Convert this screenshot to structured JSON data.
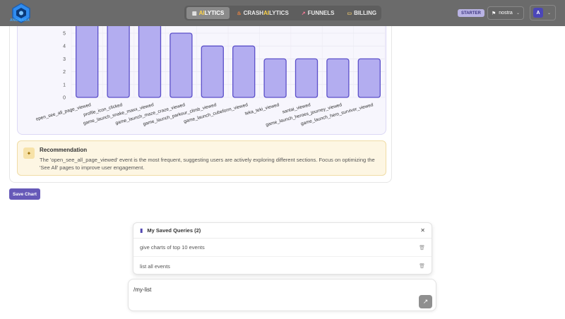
{
  "header": {
    "logo_icon": "brand-logo-icon",
    "tabs": [
      {
        "icon": "chart-icon",
        "prefix": "",
        "ai": "AI",
        "suffix": "LYTICS",
        "active": true
      },
      {
        "icon": "fire-icon",
        "prefix": "CRASH",
        "ai": "AI",
        "suffix": "LYTICS",
        "active": false
      },
      {
        "icon": "trend-icon",
        "prefix": "FUNNELS",
        "ai": "",
        "suffix": "",
        "active": false
      },
      {
        "icon": "card-icon",
        "prefix": "BILLING",
        "ai": "",
        "suffix": "",
        "active": false
      }
    ],
    "plan_badge": "STARTER",
    "project": "nostra",
    "avatar_initial": "A"
  },
  "chart_data": {
    "type": "bar",
    "categories": [
      "open_see_all_page_viewed",
      "profile_icon_clicked",
      "game_launch_snake_maxx_viewed",
      "game_launch_maze_craze_viewed",
      "game_launch_parkour_climb_viewed",
      "game_launch_cubeform_viewed",
      "teka_teki_viewed",
      "santai_viewed",
      "game_launch_heroes_journey_viewed",
      "game_launch_hero_survivor_viewed"
    ],
    "values": [
      6,
      6,
      6,
      5,
      4,
      4,
      3,
      3,
      3,
      3
    ],
    "yticks": [
      0,
      1,
      2,
      3,
      4,
      5
    ],
    "ylim": [
      0,
      6
    ],
    "grid": true,
    "colors": {
      "fill": "#b3adf0",
      "stroke": "#5b4fc9"
    }
  },
  "recommendation": {
    "icon": "lightbulb-icon",
    "title": "Recommendation",
    "text": "The 'open_see_all_page_viewed' event is the most frequent, suggesting users are actively exploring different sections. Focus on optimizing the 'See All' pages to improve user engagement."
  },
  "save_chart_label": "Save Chart",
  "saved_queries": {
    "title": "My Saved Queries (2)",
    "items": [
      "give charts of top 10 events",
      "list all events"
    ]
  },
  "command": {
    "value": "/my-list"
  },
  "colors": {
    "accent": "#6659b8",
    "topbar": "#6b6b6b"
  }
}
